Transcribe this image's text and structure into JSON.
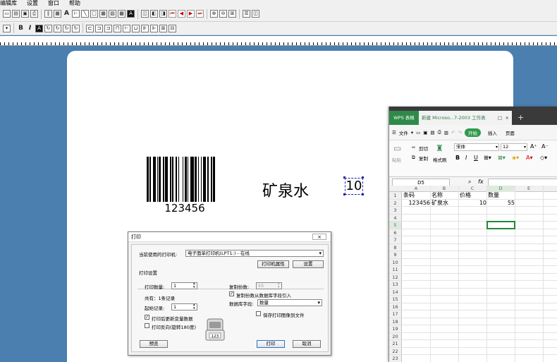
{
  "menu": [
    "编辑库",
    "设置",
    "窗口",
    "帮助"
  ],
  "canvas": {
    "barcode_text": "123456",
    "name_text": "矿泉水",
    "number_text": "10"
  },
  "print_dialog": {
    "title": "打印",
    "close": "×",
    "printer_label": "当前使用的打印机:",
    "printer_value": "电子面单打印机(LPT1:) - 在线",
    "printer_props_button": "打印机属性",
    "settings_button": "设置",
    "section_title": "打印设置",
    "print_qty_label": "打印数量:",
    "print_qty_value": "1",
    "total_records": "共有：1条记录",
    "start_record_label": "起始记录:",
    "start_record_value": "1",
    "refresh_vars_label": "打印后更新变量数据",
    "refresh_vars_checked": true,
    "reverse_label": "打印反向(旋转180度)",
    "reverse_checked": false,
    "copies_label": "复制份数:",
    "copies_value": "55",
    "copies_from_db_label": "复制份数从数据库字段引入",
    "copies_from_db_checked": true,
    "db_field_label": "数据库字段:",
    "db_field_value": "数量",
    "save_image_label": "保存打印图像到文件",
    "save_image_checked": false,
    "printer_badge": "123",
    "preview_button": "预览",
    "print_button": "打印",
    "cancel_button": "取消"
  },
  "wps": {
    "app_tab": "WPS 表格",
    "doc_tab": "新建 Microso...7-2003 工作表",
    "doc_restore": "□",
    "doc_close": "×",
    "new_tab": "+",
    "menu_items": [
      "文件",
      "开始",
      "插入",
      "页面"
    ],
    "ribbon": {
      "cut": "剪切",
      "copy": "复制",
      "paste": "粘贴",
      "format_painter": "格式刷",
      "font": "宋体",
      "size": "12",
      "bold": "B",
      "italic": "I",
      "underline": "U"
    },
    "name_box": "D5",
    "fx": "fx",
    "columns": [
      "A",
      "B",
      "C",
      "D",
      "E"
    ],
    "row_numbers": [
      "1",
      "2",
      "3",
      "4",
      "5",
      "6",
      "7",
      "8",
      "9",
      "10",
      "11",
      "12",
      "13",
      "14",
      "15",
      "16",
      "17",
      "18",
      "19",
      "20",
      "21",
      "22",
      "23"
    ],
    "header_row": [
      "条码",
      "名称",
      "价格",
      "数量"
    ],
    "data_row": [
      "123456",
      "矿泉水",
      "10",
      "55"
    ]
  }
}
